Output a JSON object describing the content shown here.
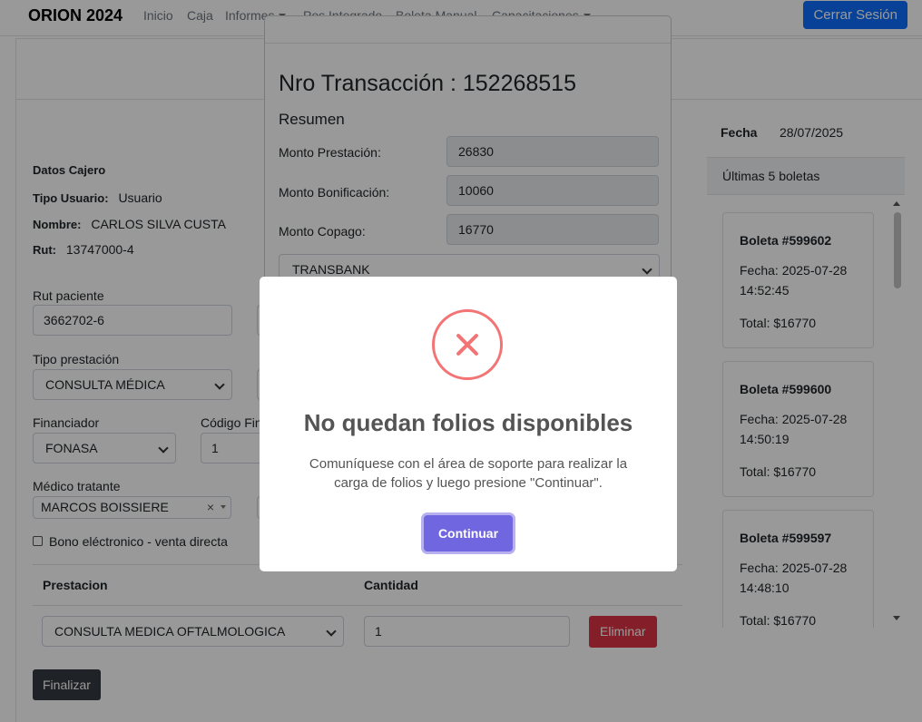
{
  "navbar": {
    "brand": "ORION 2024",
    "links": [
      "Inicio",
      "Caja",
      "Informes",
      "Pos Integrado",
      "Boleta Manual",
      "Capacitaciones"
    ],
    "logout_label": "Cerrar Sesión"
  },
  "cashier": {
    "section_title": "Datos Cajero",
    "user_type_label": "Tipo Usuario:",
    "user_type_value": "Usuario",
    "name_label": "Nombre:",
    "name_value": "CARLOS SILVA CUSTA",
    "rut_label": "Rut:",
    "rut_value": "13747000-4"
  },
  "form": {
    "rut_paciente_label": "Rut paciente",
    "rut_paciente_value": "3662702-6",
    "tipo_prestacion_label": "Tipo prestación",
    "tipo_prestacion_value": "CONSULTA MÉDICA",
    "financiador_label": "Financiador",
    "financiador_value": "FONASA",
    "codigo_label": "Código Fin",
    "codigo_value": "1",
    "medico_label": "Médico tratante",
    "medico_value": "MARCOS BOISSIERE",
    "bono_label": "Bono eléctronico - venta directa"
  },
  "table": {
    "col_prestacion": "Prestacion",
    "col_cantidad": "Cantidad",
    "row_prestacion": "CONSULTA MEDICA OFTALMOLOGICA",
    "row_cantidad": "1",
    "delete_label": "Eliminar"
  },
  "finalize_label": "Finalizar",
  "sidebar": {
    "date_label": "Fecha",
    "date_value": "28/07/2025",
    "list_title": "Últimas 5 boletas",
    "boletas": [
      {
        "title": "Boleta #599602",
        "fecha": "Fecha: 2025-07-28 14:52:45",
        "total": "Total: $16770"
      },
      {
        "title": "Boleta #599600",
        "fecha": "Fecha: 2025-07-28 14:50:19",
        "total": "Total: $16770"
      },
      {
        "title": "Boleta #599597",
        "fecha": "Fecha: 2025-07-28 14:48:10",
        "total": "Total: $16770"
      }
    ]
  },
  "transaction": {
    "title": "Nro Transacción : 152268515",
    "summary": "Resumen",
    "monto_prestacion_label": "Monto Prestación:",
    "monto_prestacion_value": "26830",
    "monto_bonificacion_label": "Monto Bonificación:",
    "monto_bonificacion_value": "10060",
    "monto_copago_label": "Monto Copago:",
    "monto_copago_value": "16770",
    "payment_method": "TRANSBANK"
  },
  "alert": {
    "icon": "error-x-icon",
    "title": "No quedan folios disponibles",
    "text": "Comuníquese con el área de soporte para realizar la carga de folios y luego presione \"Continuar\".",
    "button_label": "Continuar",
    "accent_color": "#7066e0",
    "error_color": "#f27474"
  }
}
